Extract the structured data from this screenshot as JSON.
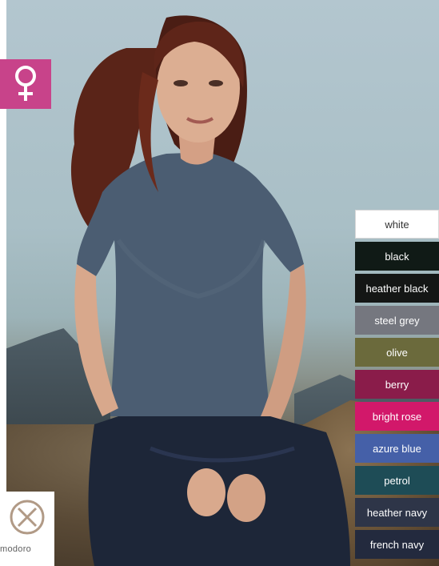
{
  "gender_badge": {
    "icon": "female-symbol-icon",
    "color": "#c8438a"
  },
  "brand": {
    "name": "modoro",
    "icon": "brand-logo-icon"
  },
  "product_image": {
    "subject": "woman-wearing-tshirt"
  },
  "colors": [
    {
      "label": "white",
      "hex": "#ffffff",
      "text": "#333333"
    },
    {
      "label": "black",
      "hex": "#101a16",
      "text": "#ffffff"
    },
    {
      "label": "heather black",
      "hex": "#141615",
      "text": "#ffffff"
    },
    {
      "label": "steel grey",
      "hex": "#75777f",
      "text": "#ffffff"
    },
    {
      "label": "olive",
      "hex": "#6b6a3c",
      "text": "#ffffff"
    },
    {
      "label": "berry",
      "hex": "#8a1c4a",
      "text": "#ffffff"
    },
    {
      "label": "bright rose",
      "hex": "#d2186a",
      "text": "#ffffff"
    },
    {
      "label": "azure blue",
      "hex": "#4560a8",
      "text": "#ffffff"
    },
    {
      "label": "petrol",
      "hex": "#1e4c56",
      "text": "#ffffff"
    },
    {
      "label": "heather navy",
      "hex": "#2e3548",
      "text": "#ffffff"
    },
    {
      "label": "french navy",
      "hex": "#232a3e",
      "text": "#ffffff"
    }
  ]
}
